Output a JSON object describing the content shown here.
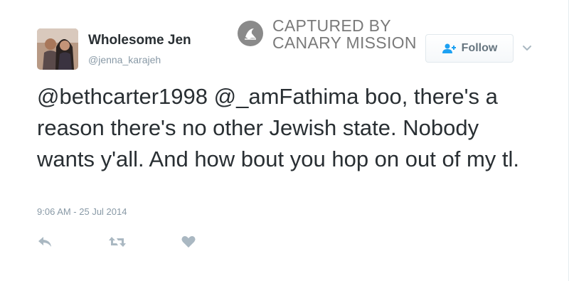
{
  "tweet": {
    "display_name": "Wholesome Jen",
    "username": "@jenna_karajeh",
    "text": "@bethcarter1998 @_amFathima boo, there's a reason there's no other Jewish state. Nobody wants y'all. And how bout you hop on out of my tl.",
    "timestamp": "9:06 AM - 25 Jul 2014"
  },
  "follow_button": {
    "label": "Follow",
    "icon": "add-user-icon"
  },
  "watermark": {
    "line1": "CAPTURED BY",
    "line2": "CANARY MISSION",
    "icon": "canary-mission-logo"
  },
  "actions": {
    "reply_icon": "reply-icon",
    "retweet_icon": "retweet-icon",
    "like_icon": "heart-icon",
    "more_icon": "chevron-down-icon"
  },
  "colors": {
    "text": "#292f33",
    "muted": "#8899a6",
    "icon": "#aab8c2",
    "watermark": "#7a7a7a",
    "follow_text": "#66757f",
    "follow_icon": "#1da1f2"
  }
}
